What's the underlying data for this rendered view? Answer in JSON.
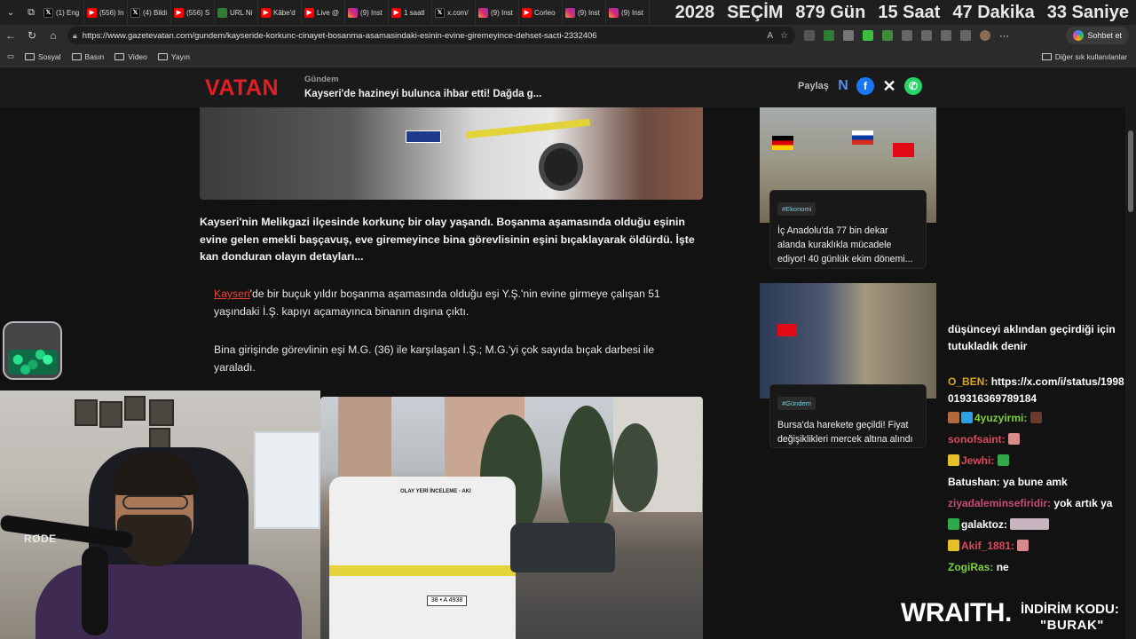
{
  "browser": {
    "tabs": [
      {
        "icon": "x",
        "label": "(1) Eng"
      },
      {
        "icon": "yt",
        "label": "(556) In"
      },
      {
        "icon": "x",
        "label": "(4) Bildi"
      },
      {
        "icon": "yt",
        "label": "(556) S"
      },
      {
        "icon": "gr",
        "label": "URL Ni"
      },
      {
        "icon": "yt",
        "label": "Kâbe'd"
      },
      {
        "icon": "yt",
        "label": "Live @"
      },
      {
        "icon": "ig",
        "label": "(9) Inst"
      },
      {
        "icon": "yt",
        "label": "1 saatl"
      },
      {
        "icon": "x",
        "label": "x.com/"
      },
      {
        "icon": "ig",
        "label": "(9) Inst"
      },
      {
        "icon": "yt",
        "label": "Corleo"
      },
      {
        "icon": "ig",
        "label": "(9) Inst"
      },
      {
        "icon": "ig",
        "label": "(9) Inst"
      }
    ],
    "url": "https://www.gazetevatan.com/gundem/kayseride-korkunc-cinayet-bosanma-asamasindaki-esinin-evine-giremeyince-dehset-sacti-2332406",
    "copilot_label": "Sohbet et",
    "bookmarks": [
      "Sosyal",
      "Basın",
      "Video",
      "Yayın"
    ],
    "other_bookmarks": "Diğer sık kullanılanlar"
  },
  "countdown": {
    "year": "2028",
    "label": "SEÇİM",
    "days": "879 Gün",
    "hours": "15 Saat",
    "minutes": "47 Dakika",
    "seconds": "33 Saniye"
  },
  "site": {
    "logo": "VATAN",
    "breadcrumb": "Gündem",
    "header_title": "Kayseri'de hazineyi bulunca ihbar etti! Dağda g...",
    "share_label": "Paylaş"
  },
  "article": {
    "lead": "Kayseri'nin Melikgazi ilçesinde korkunç bir olay yaşandı. Boşanma aşamasında olduğu eşinin evine gelen emekli başçavuş, eve giremeyince bina görevlisinin eşini bıçaklayarak öldürdü. İşte kan donduran olayın detayları...",
    "p1_link": "Kayseri",
    "p1_rest": "'de bir buçuk yıldır boşanma aşamasında olduğu eşi Y.Ş.'nin evine girmeye çalışan 51 yaşındaki İ.Ş. kapıyı açamayınca binanın dışına çıktı.",
    "p2": "Bina girişinde görevlinin eşi M.G. (36) ile karşılaşan İ.Ş.; M.G.'yi çok sayıda bıçak darbesi ile yaraladı.",
    "van_text": "OLAY YERİ İNCELEME - AKI",
    "plate": "38 • A 4938"
  },
  "sidebar": {
    "cards": [
      {
        "tag": "#Ekonomi",
        "text": "İç Anadolu'da 77 bin dekar alanda kuraklıkla mücadele ediyor! 40 günlük ekim dönemi..."
      },
      {
        "tag": "#Gündem",
        "text": "Bursa'da harekete geçildi! Fiyat değişiklikleri mercek altına alındı"
      }
    ]
  },
  "chat": {
    "lines": [
      {
        "user": "",
        "message": "düşünceyi aklından geçirdiği için tutukladık denir",
        "color": "#ffffff"
      },
      {
        "user": "O_BEN:",
        "message": "https://x.com/i/status/1998019316369789184",
        "color": "#daa520"
      },
      {
        "user": "4yuzyirmi:",
        "message": "",
        "color": "#7fd13b"
      },
      {
        "user": "sonofsaint:",
        "message": "",
        "color": "#d94a5a"
      },
      {
        "user": "Jewhi:",
        "message": "",
        "color": "#d94a5a"
      },
      {
        "user": "Batushan:",
        "message": "ya bune amk",
        "color": "#ffffff"
      },
      {
        "user": "ziyadaleminsefiridir:",
        "message": "yok artık ya",
        "color": "#c94a7a"
      },
      {
        "user": "galaktoz:",
        "message": "",
        "color": "#ffffff"
      },
      {
        "user": "Akif_1881:",
        "message": "",
        "color": "#d94a5a"
      },
      {
        "user": "ZogiRas:",
        "message": "ne",
        "color": "#7fd13b"
      }
    ]
  },
  "overlay": {
    "mic_brand": "RØDE",
    "sponsor_brand": "WRAITH.",
    "sponsor_label": "İNDİRİM KODU:",
    "sponsor_code": "\"BURAK\""
  },
  "colors": {
    "brand_red": "#e41e26",
    "link_red": "#e8433c",
    "page_bg": "#121212"
  }
}
